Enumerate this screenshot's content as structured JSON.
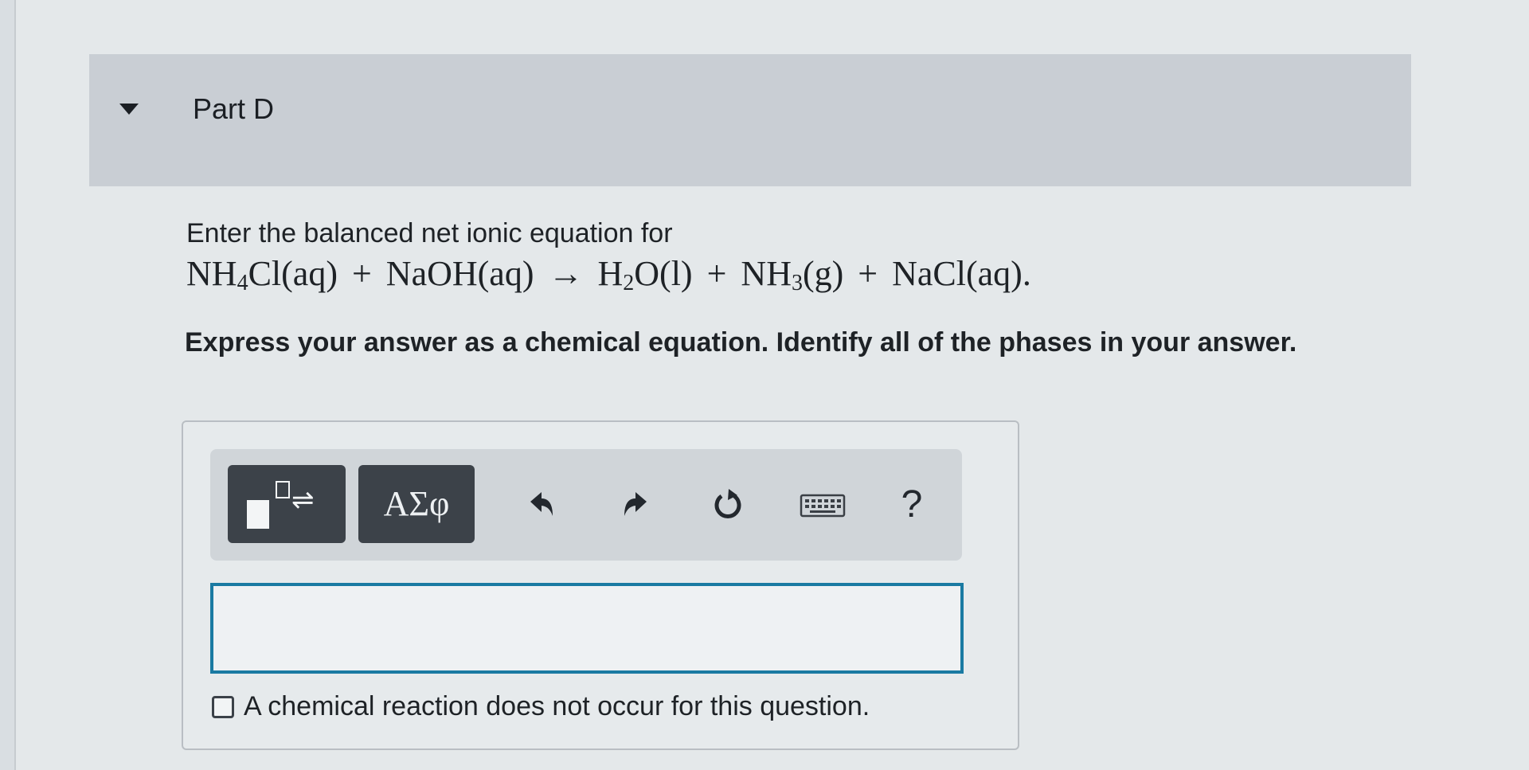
{
  "part": {
    "title": "Part D"
  },
  "question": {
    "prompt": "Enter the balanced net ionic equation for",
    "equation": {
      "r1_main": "NH",
      "r1_sub": "4",
      "r1_rest": "Cl(aq)",
      "plus1": "+",
      "r2": "NaOH(aq)",
      "arrow": "→",
      "p1_main": "H",
      "p1_sub": "2",
      "p1_rest": "O(l)",
      "plus2": "+",
      "p2_main": "NH",
      "p2_sub": "3",
      "p2_rest": "(g)",
      "plus3": "+",
      "p3": "NaCl(aq)."
    },
    "instruction": "Express your answer as a chemical equation. Identify all of the phases in your answer."
  },
  "toolbar": {
    "symbols_label": "ΑΣφ",
    "help_label": "?",
    "icons": [
      "templates-icon",
      "undo-icon",
      "redo-icon",
      "reset-icon",
      "keyboard-icon",
      "help-icon"
    ]
  },
  "answer": {
    "value": "",
    "placeholder": ""
  },
  "no_reaction": {
    "label": "A chemical reaction does not occur for this question."
  },
  "colors": {
    "header_bg": "#c9ced4",
    "tool_button": "#3c4249",
    "input_border": "#1a7aa2"
  }
}
